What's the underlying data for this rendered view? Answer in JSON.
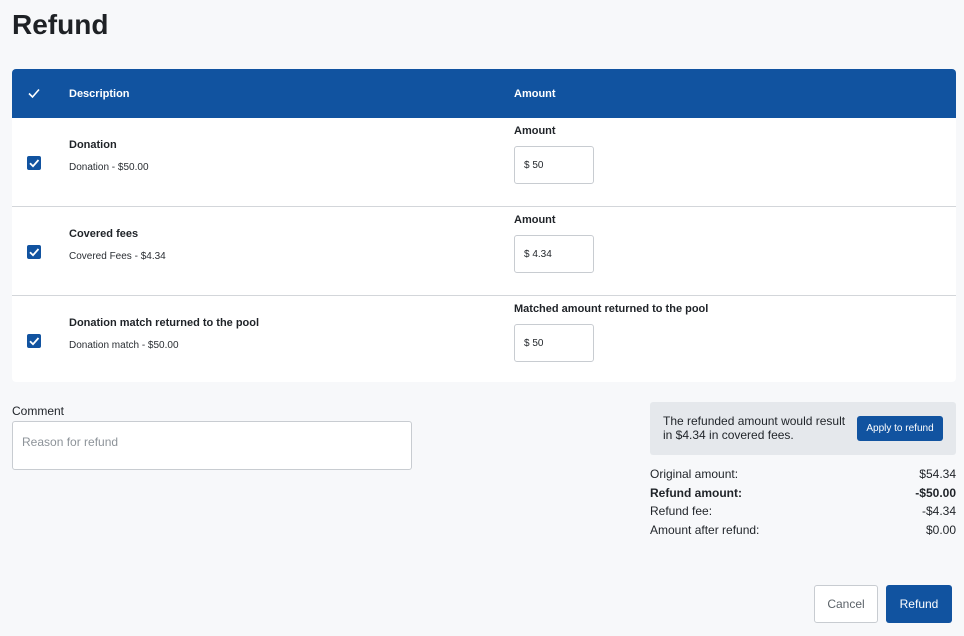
{
  "page": {
    "title": "Refund"
  },
  "table": {
    "header": {
      "description": "Description",
      "amount": "Amount"
    },
    "rows": [
      {
        "checked": true,
        "title": "Donation",
        "subtitle": "Donation - $50.00",
        "amount_label": "Amount",
        "amount_value": "$ 50"
      },
      {
        "checked": true,
        "title": "Covered fees",
        "subtitle": "Covered Fees - $4.34",
        "amount_label": "Amount",
        "amount_value": "$ 4.34"
      },
      {
        "checked": true,
        "title": "Donation match returned to the pool",
        "subtitle": "Donation match - $50.00",
        "amount_label": "Matched amount returned to the pool",
        "amount_value": "$ 50"
      }
    ]
  },
  "comment": {
    "label": "Comment",
    "placeholder": "Reason for refund"
  },
  "fee_notice": {
    "text": "The refunded amount would result in $4.34 in covered fees.",
    "button_label": "Apply to refund"
  },
  "summary": [
    {
      "label": "Original amount:",
      "value": "$54.34"
    },
    {
      "label": "Refund amount:",
      "value": "-$50.00"
    },
    {
      "label": "Refund fee:",
      "value": "-$4.34"
    },
    {
      "label": "Amount after refund:",
      "value": "$0.00"
    }
  ],
  "actions": {
    "cancel_label": "Cancel",
    "refund_label": "Refund"
  },
  "colors": {
    "primary": "#1153a0",
    "background": "#f7f8fa",
    "notice_bg": "#e5e8ec"
  }
}
